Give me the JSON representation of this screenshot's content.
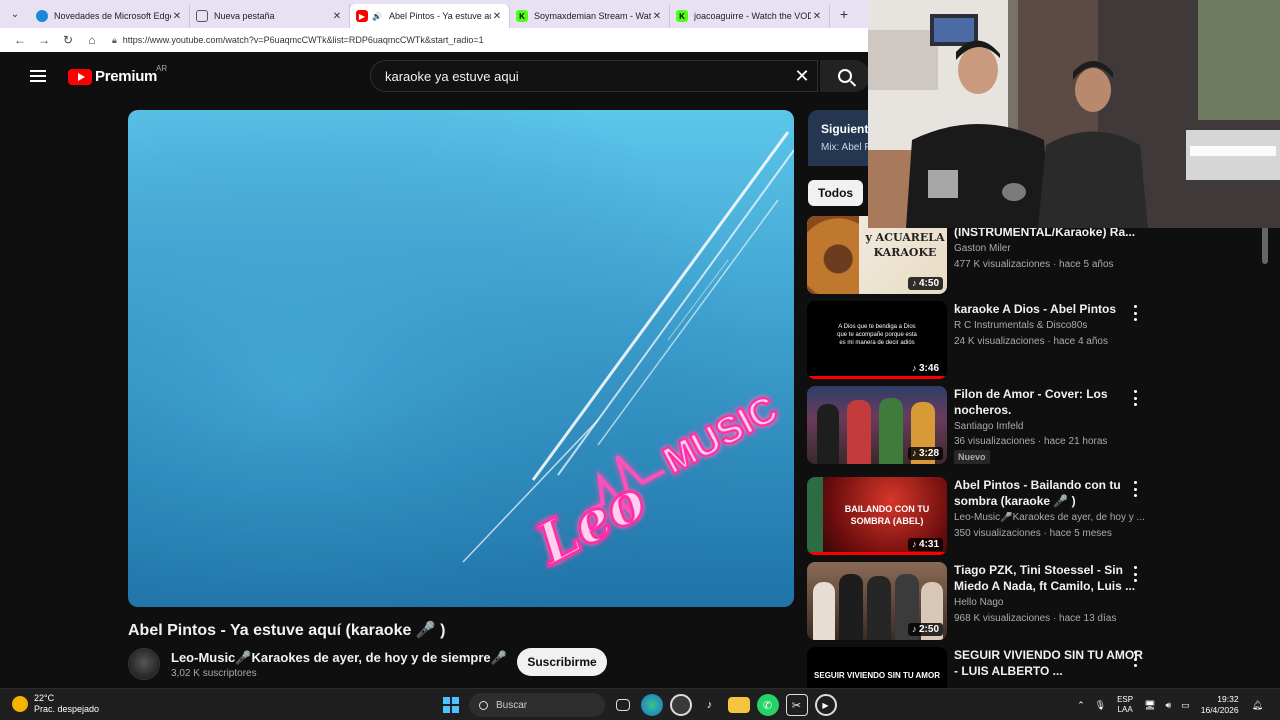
{
  "browser": {
    "tabs": [
      {
        "title": "Novedades de Microsoft Edge",
        "favicon_color": "#1b8ad6",
        "active": false
      },
      {
        "title": "Nueva pestaña",
        "favicon_color": "#777777",
        "active": false
      },
      {
        "title": "Abel Pintos - Ya estuve aquí (k",
        "favicon_color": "#ff0000",
        "active": true
      },
      {
        "title": "Soymaxdemian Stream - Watch Li",
        "favicon_color": "#53fc18",
        "active": false
      },
      {
        "title": "joacoaguirre - Watch the VOD on",
        "favicon_color": "#53fc18",
        "active": false
      }
    ],
    "url": "https://www.youtube.com/watch?v=P6uaqmcCWTk&list=RDP6uaqmcCWTk&start_radio=1"
  },
  "youtube": {
    "brand": "Premium",
    "country": "AR",
    "search_query": "karaoke ya estuve aqui"
  },
  "video": {
    "title": "Abel Pintos - Ya estuve aquí (karaoke 🎤 )",
    "channel": "Leo-Music🎤Karaokes de ayer, de hoy y de siempre🎤",
    "subscribers": "3,02 K suscriptores",
    "subscribe_label": "Suscribirme",
    "logo_text_1": "Leo",
    "logo_text_2": "MUSIC"
  },
  "sidebar": {
    "playlist_title": "Siguiente",
    "playlist_sub": "Mix: Abel P",
    "chip": "Todos",
    "items": [
      {
        "title": "Zamba y Acuarela (INSTRUMENTAL/Karaoke) Ra...",
        "channel": "Gaston Miler",
        "meta": "477 K visualizaciones · hace 5 años",
        "duration": "4:50",
        "badge": "",
        "thumb": "zamba",
        "thumb_text": "y ACUARELA KARAOKE"
      },
      {
        "title": "karaoke A Dios - Abel Pintos",
        "channel": "R C Instrumentals & Disco80s",
        "meta": "24 K visualizaciones · hace 4 años",
        "duration": "3:46",
        "badge": "",
        "thumb": "dios",
        "thumb_text": "A Dios que te bendiga a Dios que te acompañe porque esta es mi manera de decir adiós"
      },
      {
        "title": "Filon de Amor - Cover: Los nocheros.",
        "channel": "Santiago Imfeld",
        "meta": "36 visualizaciones · hace 21 horas",
        "duration": "3:28",
        "badge": "Nuevo",
        "thumb": "band",
        "thumb_text": ""
      },
      {
        "title": "Abel Pintos - Bailando con tu sombra (karaoke 🎤 )",
        "channel": "Leo-Music🎤Karaokes de ayer, de hoy y ...",
        "meta": "350 visualizaciones · hace 5 meses",
        "duration": "4:31",
        "badge": "",
        "thumb": "bailando",
        "thumb_text": "BAILANDO CON TU SOMBRA (ABEL)"
      },
      {
        "title": "Tiago PZK, Tini Stoessel - Sin Miedo A Nada, ft Camilo, Luis ...",
        "channel": "Hello Nago",
        "meta": "968 K visualizaciones · hace 13 días",
        "duration": "2:50",
        "badge": "",
        "thumb": "group",
        "thumb_text": ""
      },
      {
        "title": "SEGUIR VIVIENDO SIN TU AMOR - LUIS ALBERTO ...",
        "channel": "",
        "meta": "",
        "duration": "",
        "badge": "",
        "thumb": "seguir",
        "thumb_text": "SEGUIR VIVIENDO SIN TU AMOR"
      }
    ]
  },
  "taskbar": {
    "temperature": "22°C",
    "weather": "Prac. despejado",
    "search_placeholder": "Buscar",
    "lang_1": "ESP",
    "lang_2": "LAA",
    "time": "19:32",
    "date": "16/4/2026"
  }
}
